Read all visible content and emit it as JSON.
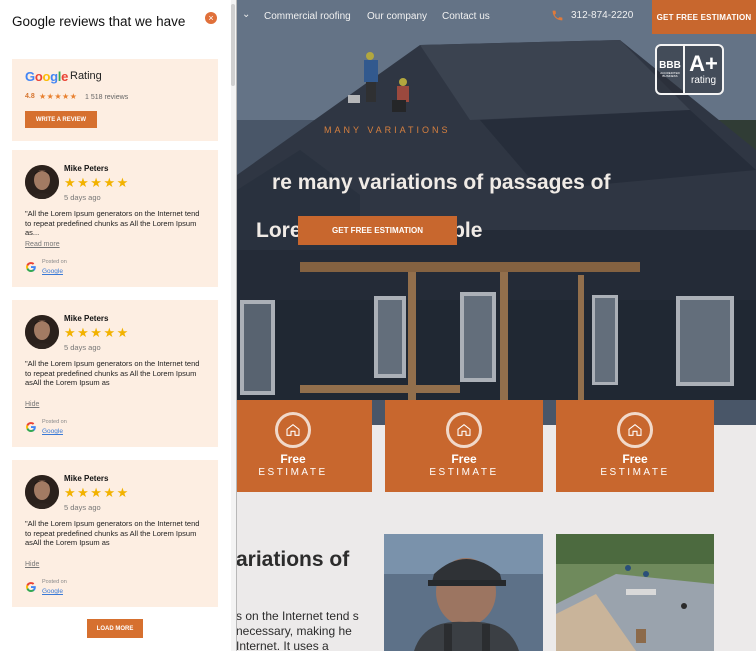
{
  "nav": {
    "links": [
      "Commercial roofing",
      "Our company",
      "Contact us"
    ],
    "chevron": "⌄",
    "phone": "312-874-2220",
    "cta": "GET FREE ESTIMATION",
    "phone_icon": "phone-icon"
  },
  "bbb": {
    "mark": "BBB",
    "accredited": "ACCREDITED BUSINESS",
    "grade": "A+",
    "grade_label": "rating"
  },
  "hero": {
    "eyebrow": "MANY VARIATIONS",
    "title_line1": "re many variations of passages of",
    "title_line2": "Lorem Ipsum available",
    "cta": "GET FREE ESTIMATION"
  },
  "cards": [
    {
      "title": "Free",
      "subtitle": "ESTIMATE",
      "icon": "house-icon"
    },
    {
      "title": "Free",
      "subtitle": "ESTIMATE",
      "icon": "house-icon"
    },
    {
      "title": "Free",
      "subtitle": "ESTIMATE",
      "icon": "house-icon"
    }
  ],
  "lower": {
    "title": "ariations of",
    "text": "s on the Internet tend s necessary, making he Internet. It uses a"
  },
  "panel": {
    "title": "Google reviews that we have",
    "close": "×",
    "summary": {
      "brand": [
        "G",
        "o",
        "o",
        "g",
        "l",
        "e"
      ],
      "rating_word": "Rating",
      "score": "4.8",
      "stars": "★★★★★",
      "count": "1 518 reviews",
      "write_button": "WRITE A REVIEW"
    },
    "reviews": [
      {
        "name": "Mike Peters",
        "stars": "★★★★★",
        "date": "5 days ago",
        "text": "\"All the Lorem Ipsum generators on the Internet tend to repeat predefined chunks as All the Lorem Ipsum as...",
        "toggle": "Read more",
        "posted_label": "Posted on",
        "posted_link": "Google"
      },
      {
        "name": "Mike Peters",
        "stars": "★★★★★",
        "date": "5 days ago",
        "text": "\"All the Lorem Ipsum generators on the Internet tend to repeat predefined chunks as All the Lorem Ipsum asAll the Lorem Ipsum as",
        "toggle": "Hide",
        "posted_label": "Posted on",
        "posted_link": "Google"
      },
      {
        "name": "Mike Peters",
        "stars": "★★★★★",
        "date": "5 days ago",
        "text": "\"All the Lorem Ipsum generators on the Internet tend to repeat predefined chunks as All the Lorem Ipsum asAll the Lorem Ipsum as",
        "toggle": "Hide",
        "posted_label": "Posted on",
        "posted_link": "Google"
      }
    ],
    "load_more": "LOAD MORE"
  },
  "colors": {
    "accent": "#c8672e",
    "panel_card": "#fdeee2",
    "star": "#f2b200",
    "google_blue": "#4285F4",
    "google_red": "#EA4335",
    "google_yellow": "#FBBC05",
    "google_green": "#34A853"
  }
}
